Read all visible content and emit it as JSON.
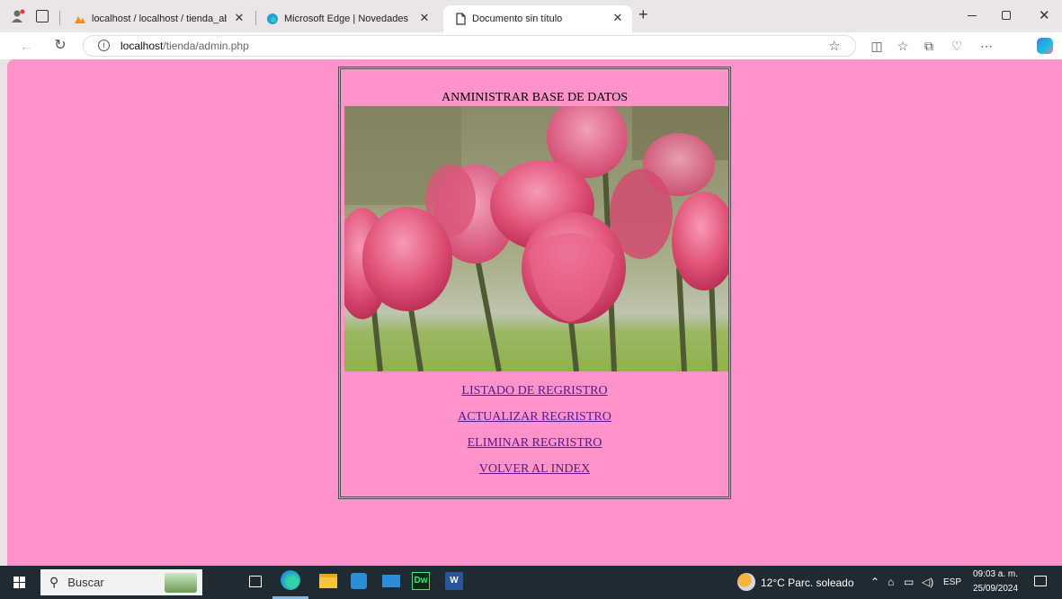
{
  "browser": {
    "tabs": [
      {
        "label": "localhost / localhost / tienda_aba",
        "close": "✕"
      },
      {
        "label": "Microsoft Edge | Novedades",
        "close": "✕"
      },
      {
        "label": "Documento sin título",
        "close": "✕"
      }
    ],
    "new_tab": "+",
    "url_host": "localhost",
    "url_path": "/tienda/admin.php"
  },
  "page": {
    "title": "ANMINISTRAR BASE DE DATOS",
    "links": [
      {
        "label": "LISTADO DE REGRISTRO"
      },
      {
        "label": "ACTUALIZAR REGRISTRO"
      },
      {
        "label": "ELIMINAR REGRISTRO"
      },
      {
        "label": "VOLVER AL INDEX"
      }
    ],
    "background_color": "#ff93ca",
    "link_color": "#551a8b"
  },
  "taskbar": {
    "search_placeholder": "Buscar",
    "weather": "12°C  Parc. soleado",
    "language": "ESP",
    "time": "09:03 a. m.",
    "date": "25/09/2024"
  }
}
